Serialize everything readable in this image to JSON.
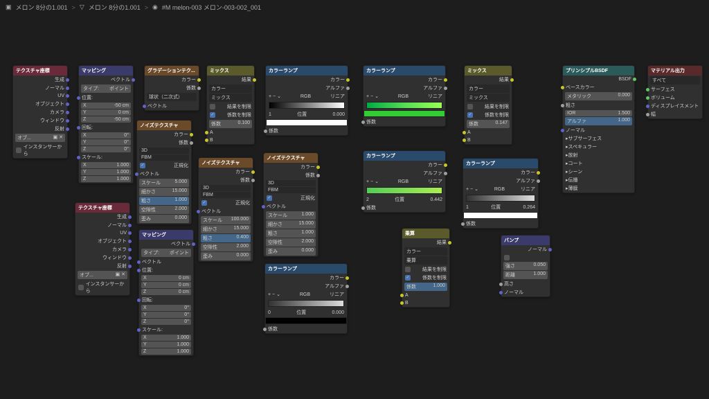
{
  "breadcrumb": {
    "item1": "メロン 8分の1.001",
    "item2": "メロン 8分の1.001",
    "item3": "#M melon-003 メロン-003-002_001"
  },
  "sep": ">",
  "nodes": {
    "texcoord1": {
      "title": "テクスチャ座標",
      "outputs": [
        "生成",
        "ノーマル",
        "UV",
        "オブジェクト",
        "カメラ",
        "ウィンドウ",
        "反射"
      ],
      "obj": "オブ...",
      "inst": "インスタンサーから"
    },
    "texcoord2": {
      "title": "テクスチャ座標"
    },
    "mapping1": {
      "title": "マッピング",
      "vec": "ベクトル",
      "type": "タイプ:",
      "point": "ポイント",
      "loc": "位置:",
      "x": "X",
      "y": "Y",
      "z": "Z",
      "xv": "-50 cm",
      "yv": "0 cm",
      "zv": "-50 cm",
      "rot": "回転:",
      "rxv": "0°",
      "ryv": "0°",
      "rzv": "0°",
      "scale": "スケール:",
      "sv": "1.000"
    },
    "mapping2": {
      "title": "マッピング",
      "xv": "0 cm",
      "zv": "0 cm"
    },
    "gradient": {
      "title": "グラデーションテク...",
      "col": "カラー",
      "fac": "係数",
      "sphere": "球状（二次式）",
      "vec": "ベクトル"
    },
    "noise1": {
      "title": "ノイズテクスチャ",
      "col": "カラー",
      "fac": "係数",
      "dim": "3D",
      "fbm": "FBM",
      "norm": "正規化",
      "vec": "ベクトル",
      "scale": "スケール",
      "scalev": "5.000",
      "detail": "細かさ",
      "detailv": "15.000",
      "rough": "粗さ",
      "roughv": "1.000",
      "lac": "空隙性",
      "lacv": "2.000",
      "dist": "歪み",
      "distv": "0.000"
    },
    "noise2": {
      "title": "ノイズテクスチャ",
      "scalev": "100.000",
      "detailv": "15.000",
      "roughv": "0.400",
      "lacv": "2.000",
      "distv": "0.000"
    },
    "noise3": {
      "title": "ノイズテクスチャ",
      "scalev": "1.000",
      "detailv": "15.000",
      "roughv": "1.000",
      "lacv": "2.000",
      "distv": "0.000"
    },
    "mix1": {
      "title": "ミックス",
      "result": "結果",
      "col": "カラー",
      "mix": "ミックス",
      "clamp1": "結果を制限",
      "clamp2": "係数を制限",
      "fac": "係数",
      "facv": "0.100",
      "a": "A",
      "b": "B"
    },
    "mix2": {
      "title": "ミックス",
      "facv": "0.147"
    },
    "mix3": {
      "title": "乗算",
      "mul": "乗算",
      "facv": "1.000"
    },
    "ramp1": {
      "title": "カラーランプ",
      "col": "カラー",
      "alpha": "アルファ",
      "rgb": "RGB",
      "lin": "リニア",
      "pos": "位置",
      "posv": "0.000",
      "idx": "1",
      "fac": "係数"
    },
    "ramp2": {
      "title": "カラーランプ"
    },
    "ramp3": {
      "title": "カラーランプ",
      "idx": "2",
      "posv": "0.442"
    },
    "ramp4": {
      "title": "カラーランプ",
      "idx": "0",
      "posv": "0.000"
    },
    "ramp5": {
      "title": "カラーランプ",
      "idx": "1",
      "posv": "0.264"
    },
    "bump": {
      "title": "バンプ",
      "normal": "ノーマル",
      "str": "強さ",
      "strv": "0.050",
      "dist": "距離",
      "distv": "1.000",
      "height": "高さ"
    },
    "bsdf": {
      "title": "プリンシプルBSDF",
      "out": "BSDF",
      "base": "ベースカラー",
      "metal": "メタリック",
      "metalv": "0.000",
      "rough": "粗さ",
      "ior": "IOR",
      "iorv": "1.500",
      "alpha": "アルファ",
      "alphav": "1.000",
      "normal": "ノーマル",
      "sub": [
        "サブサーフェス",
        "スペキュラー",
        "放射",
        "コート",
        "シーン",
        "伝播",
        "薄膜"
      ]
    },
    "output": {
      "title": "マテリアル出力",
      "all": "すべて",
      "surf": "サーフェス",
      "vol": "ボリューム",
      "disp": "ディスプレイスメント",
      "thick": "幅"
    }
  }
}
